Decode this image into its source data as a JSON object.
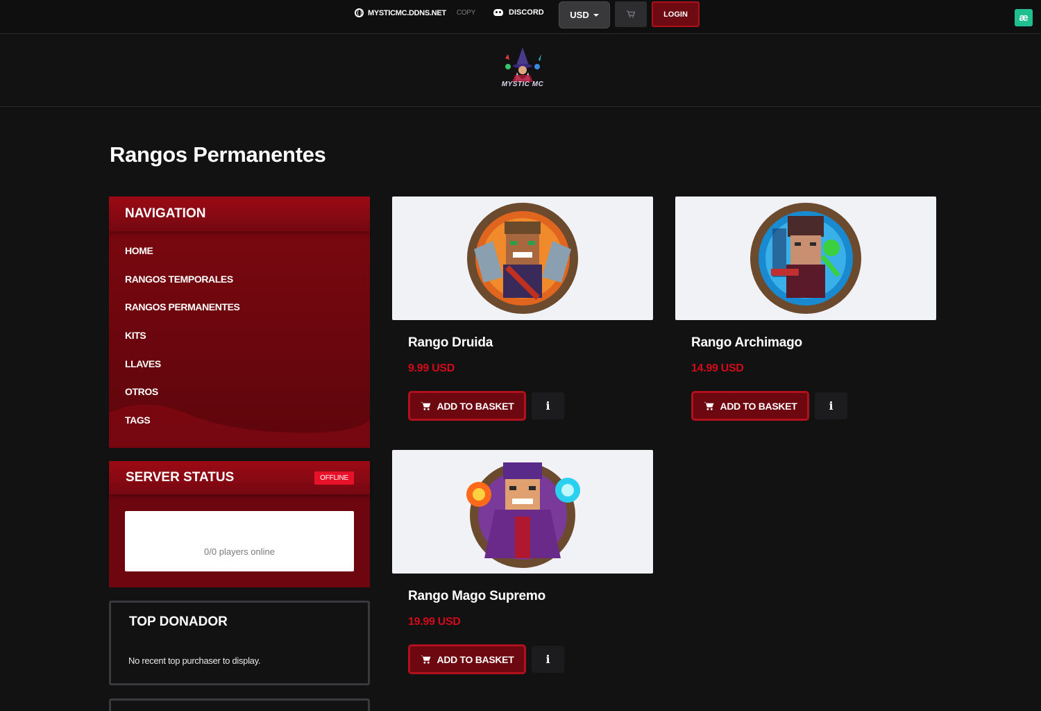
{
  "topbar": {
    "server_ip": "MYSTICMC.DDNS.NET",
    "copy_label": "COPY",
    "discord_label": "DISCORD",
    "currency": "USD",
    "login_label": "LOGIN",
    "ae_badge": "æ"
  },
  "brand": {
    "logo_text": "MYSTIC MC"
  },
  "page": {
    "title": "Rangos Permanentes"
  },
  "navigation": {
    "title": "NAVIGATION",
    "items": [
      "HOME",
      "RANGOS TEMPORALES",
      "RANGOS PERMANENTES",
      "KITS",
      "LLAVES",
      "OTROS",
      "TAGS"
    ]
  },
  "server_status": {
    "title": "SERVER STATUS",
    "badge": "OFFLINE",
    "players_text": "0/0 players online"
  },
  "top_donador": {
    "title": "TOP DONADOR",
    "text": "No recent top purchaser to display."
  },
  "products": [
    {
      "name": "Rango Druida",
      "price": "9.99 USD",
      "add_label": "ADD TO BASKET",
      "info_label": "i"
    },
    {
      "name": "Rango Archimago",
      "price": "14.99 USD",
      "add_label": "ADD TO BASKET",
      "info_label": "i"
    },
    {
      "name": "Rango Mago Supremo",
      "price": "19.99 USD",
      "add_label": "ADD TO BASKET",
      "info_label": "i"
    }
  ],
  "colors": {
    "accent": "#b1111d",
    "panel_red": "#7d0810",
    "price_red": "#d20a1a",
    "background": "#121213"
  }
}
